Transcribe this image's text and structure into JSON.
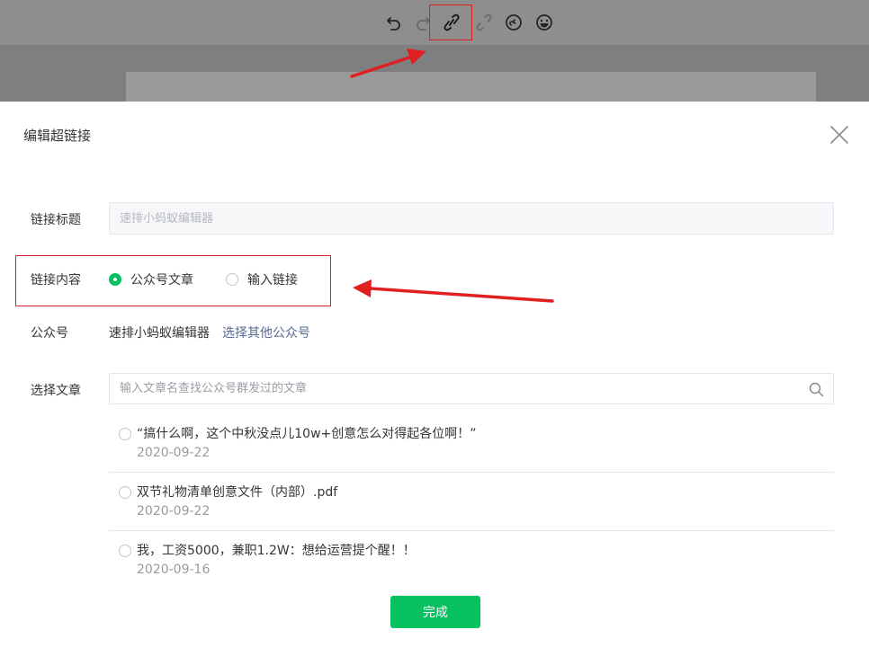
{
  "toolbar": {
    "icons": [
      "undo-icon",
      "redo-icon",
      "link-icon",
      "unlink-icon",
      "mini-program-icon",
      "emoji-icon"
    ]
  },
  "dialog": {
    "title": "编辑超链接",
    "link_title_label": "链接标题",
    "link_title_placeholder": "速排小蚂蚁编辑器",
    "link_content_label": "链接内容",
    "options": [
      {
        "label": "公众号文章",
        "checked": true
      },
      {
        "label": "输入链接",
        "checked": false
      }
    ],
    "account_label": "公众号",
    "account_name": "速排小蚂蚁编辑器",
    "choose_other_account": "选择其他公众号",
    "select_article_label": "选择文章",
    "search_placeholder": "输入文章名查找公众号群发过的文章",
    "articles": [
      {
        "title": "“搞什么啊，这个中秋没点儿10w+创意怎么对得起各位啊！”",
        "date": "2020-09-22"
      },
      {
        "title": "双节礼物清单创意文件（内部）.pdf",
        "date": "2020-09-22"
      },
      {
        "title": "我，工资5000，兼职1.2W：想给运营提个醒！！",
        "date": "2020-09-16"
      }
    ],
    "done_label": "完成"
  },
  "colors": {
    "accent_green": "#07c160",
    "link_blue": "#576b95",
    "annotation_red": "#e02020"
  }
}
